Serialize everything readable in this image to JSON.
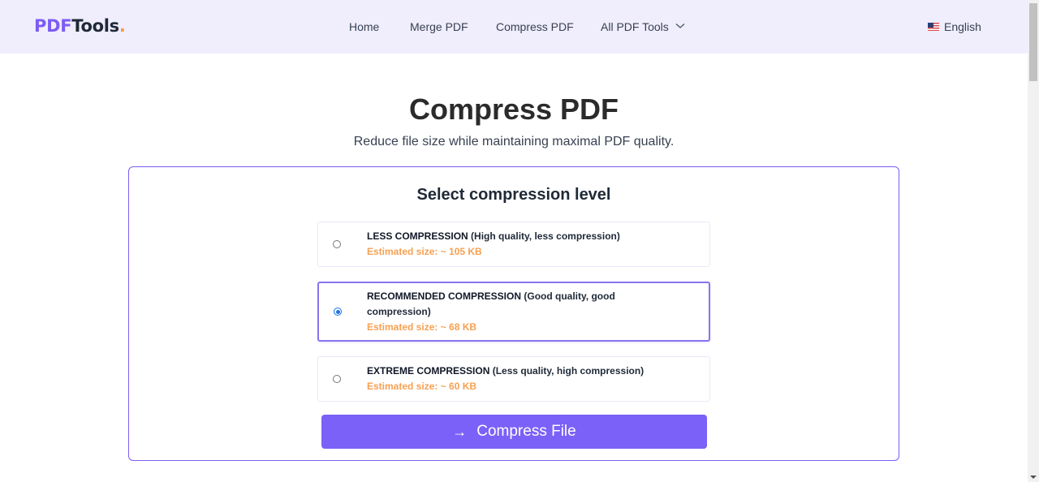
{
  "brand": {
    "part1": "PDF",
    "part2": "Tools",
    "dot": "."
  },
  "nav": {
    "items": [
      {
        "label": "Home"
      },
      {
        "label": "Merge PDF"
      },
      {
        "label": "Compress PDF"
      },
      {
        "label": "All PDF Tools"
      }
    ],
    "language": "English"
  },
  "header": {
    "title": "Compress PDF",
    "subtitle": "Reduce file size while maintaining maximal PDF quality."
  },
  "panel": {
    "title": "Select compression level",
    "options": [
      {
        "level": "LESS COMPRESSION",
        "desc": "(High quality, less compression)",
        "size": "Estimated size: ~ 105 KB",
        "selected": false
      },
      {
        "level": "RECOMMENDED COMPRESSION",
        "desc": "(Good quality, good compression)",
        "size": "Estimated size: ~ 68 KB",
        "selected": true
      },
      {
        "level": "EXTREME COMPRESSION",
        "desc": "(Less quality, high compression)",
        "size": "Estimated size: ~ 60 KB",
        "selected": false
      }
    ],
    "button_label": "Compress File",
    "button_icon": "→"
  },
  "colors": {
    "accent": "#7b61f7",
    "estimate": "#f7a052",
    "nav_bg": "#f0edfd"
  }
}
